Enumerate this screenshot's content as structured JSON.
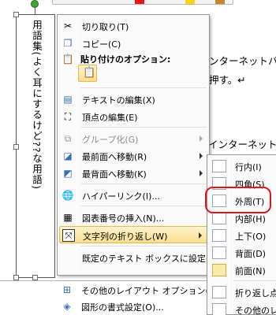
{
  "textbox": {
    "vertical_text": "用語集(よく耳にするけど??な用語)"
  },
  "document": {
    "line1": "ンターネットバ",
    "line2": "押す。↵",
    "line3": "インターネット"
  },
  "context_menu": {
    "items": [
      {
        "label": "切り取り(T)",
        "icon": "scissors-icon"
      },
      {
        "label": "コピー(C)",
        "icon": "copy-icon"
      },
      {
        "label": "貼り付けのオプション:",
        "icon": "paste-options-icon"
      },
      {
        "label": "テキストの編集(X)",
        "icon": "edit-text-icon"
      },
      {
        "label": "頂点の編集(E)",
        "icon": "edit-points-icon"
      },
      {
        "label": "グループ化(G)",
        "icon": "group-icon"
      },
      {
        "label": "最前面へ移動(R)",
        "icon": "bring-to-front-icon"
      },
      {
        "label": "最背面へ移動(K)",
        "icon": "send-to-back-icon"
      },
      {
        "label": "ハイパーリンク(I)...",
        "icon": "hyperlink-icon"
      },
      {
        "label": "図表番号の挿入(N)...",
        "icon": "insert-caption-icon"
      },
      {
        "label": "文字列の折り返し(W)",
        "icon": "text-wrap-icon"
      },
      {
        "label": "既定のテキスト ボックスに設定(D)",
        "icon": ""
      },
      {
        "label": "その他のレイアウト オプション(L)...",
        "icon": "layout-options-icon"
      },
      {
        "label": "図形の書式設定(O)...",
        "icon": "format-shape-icon"
      }
    ]
  },
  "wrap_submenu": {
    "items": [
      {
        "label": "行内(I)",
        "icon": "inline-icon"
      },
      {
        "label": "四角(S)",
        "icon": "square-icon"
      },
      {
        "label": "外周(T)",
        "icon": "tight-icon"
      },
      {
        "label": "内部(H)",
        "icon": "through-icon"
      },
      {
        "label": "上下(O)",
        "icon": "top-bottom-icon"
      },
      {
        "label": "背面(D)",
        "icon": "behind-text-icon"
      },
      {
        "label": "前面(N)",
        "icon": "in-front-icon"
      },
      {
        "label": "折り返し点の",
        "icon": "edit-wrap-points-icon"
      },
      {
        "label": "その他のレイア",
        "icon": "more-layout-icon"
      }
    ]
  },
  "colors": {
    "menu_bg": "#fafafa",
    "highlight_start": "#fdf2cc",
    "highlight_end": "#fbdf8f",
    "annotation_red": "#e0141d",
    "rotate_handle_green": "#3ea832"
  }
}
